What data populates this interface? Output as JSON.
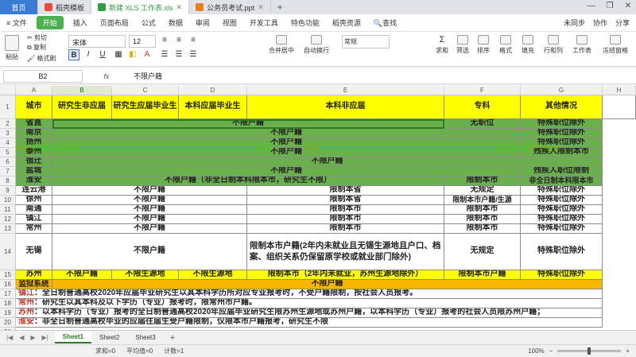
{
  "tabs": [
    {
      "label": "首页"
    },
    {
      "label": "稻壳模板"
    },
    {
      "label": "新建 XLS 工作表.xls"
    },
    {
      "label": "公务员考试.ppt"
    }
  ],
  "tab_new": "+",
  "menu": {
    "file": "≡ 文件",
    "items": [
      "开始",
      "插入",
      "页面布局",
      "公式",
      "数据",
      "审阅",
      "视图",
      "开发工具",
      "特色功能",
      "稻壳资源"
    ],
    "search": "查找",
    "right": [
      "未同步",
      "协作",
      "分享"
    ]
  },
  "ribbon": {
    "paste": "粘贴",
    "cut": "剪切",
    "copy": "复制",
    "format_painter": "格式刷",
    "font": "宋体",
    "size": "12",
    "bold": "B",
    "italic": "I",
    "underline": "U",
    "merge": "合并居中",
    "wrap": "自动换行",
    "number_format": "常规",
    "sum": "求和",
    "filter": "筛选",
    "sort": "排序",
    "format": "格式",
    "fill": "填充",
    "rowcol": "行和列",
    "worksheet": "工作表",
    "freeze": "冻结窗格"
  },
  "formula_bar": {
    "cell_ref": "B2",
    "fx": "fx",
    "content": "不限户籍"
  },
  "columns": [
    "A",
    "B",
    "C",
    "D",
    "E",
    "F",
    "G",
    "H"
  ],
  "rows": [
    "1",
    "2",
    "3",
    "4",
    "5",
    "6",
    "7",
    "8",
    "9",
    "10",
    "11",
    "12",
    "13",
    "14",
    "15",
    "16",
    "17",
    "18",
    "19",
    "20",
    "21"
  ],
  "table": {
    "header": [
      "城市",
      "研究生非应届",
      "研究生应届毕业生",
      "本科应届毕业生",
      "本科非应届",
      "专科",
      "其他情况"
    ],
    "r2": [
      "省直",
      "不限户籍",
      "无职位",
      "特殊职位除外"
    ],
    "r3": [
      "南京",
      "不限户籍",
      "特殊职位除外"
    ],
    "r4": [
      "扬州",
      "不限户籍",
      "特殊职位除外"
    ],
    "r5": [
      "泰州",
      "不限户籍",
      "残疾人限制本市"
    ],
    "r6": [
      "宿迁",
      "不限户籍"
    ],
    "r7": [
      "盐城",
      "不限户籍",
      "残疾人职位限制"
    ],
    "r8": [
      "淮安",
      "不限户籍（非全日制本科限本市，研究生不限）",
      "限制本市",
      "非全日制本科限本市"
    ],
    "r9": [
      "连云港",
      "不限户籍",
      "限制本省",
      "无规定",
      "特殊职位除外"
    ],
    "r10": [
      "徐州",
      "不限户籍",
      "限制本省",
      "限制本市户籍/生源",
      "特殊职位除外"
    ],
    "r11": [
      "南通",
      "不限户籍",
      "限制本市",
      "限制本市",
      "特殊职位除外"
    ],
    "r12": [
      "镇江",
      "不限户籍",
      "限制本市",
      "限制本市",
      "特殊职位除外"
    ],
    "r13": [
      "常州",
      "不限户籍",
      "限制本市",
      "限制本市",
      "特殊职位除外"
    ],
    "r14": [
      "无锡",
      "不限户籍",
      "限制本市户籍(2年内未就业且无锡生源地且户口、档案、组织关系仍保留原学校或就业部门除外)",
      "无规定",
      "特殊职位除外"
    ],
    "r15": [
      "苏州",
      "不限户籍",
      "不限生源地",
      "不限生源地",
      "限制本市（2年内未就业，苏州生源地除外）",
      "限制本市户籍",
      "特殊职位除外"
    ],
    "r16": [
      "监狱系统",
      "不限户籍"
    ],
    "notes": [
      {
        "city": "镇江",
        "text": "：全日制普通高校2020年应届毕业研究生以其本科学历所对应专业报考时，不受户籍限制，按社会人员报考。"
      },
      {
        "city": "常州",
        "text": "：研究生以其本科及以下学历（专业）报考时，限常州市户籍。"
      },
      {
        "city": "苏州",
        "text": "：以本科学历（专业）报考的全日制普通高校2020年应届毕业研究生限苏州生源地或苏州户籍，以本科学历（专业）报考的社会人员限苏州户籍；"
      },
      {
        "city": "淮安",
        "text": "：非全日制普通高校毕业的应届往届生受户籍限制，仅限本市户籍报考，研究生不限"
      }
    ]
  },
  "sheets": [
    "Sheet1",
    "Sheet2",
    "Sheet3"
  ],
  "sheet_add": "+",
  "status": {
    "sum": "求和=0",
    "avg": "平均值=0",
    "count": "计数=1",
    "zoom": "100%"
  },
  "colors": {
    "yellow": "#ffff00",
    "green": "#6ab04c",
    "orange": "#f7b500",
    "accent": "#4caf50"
  }
}
